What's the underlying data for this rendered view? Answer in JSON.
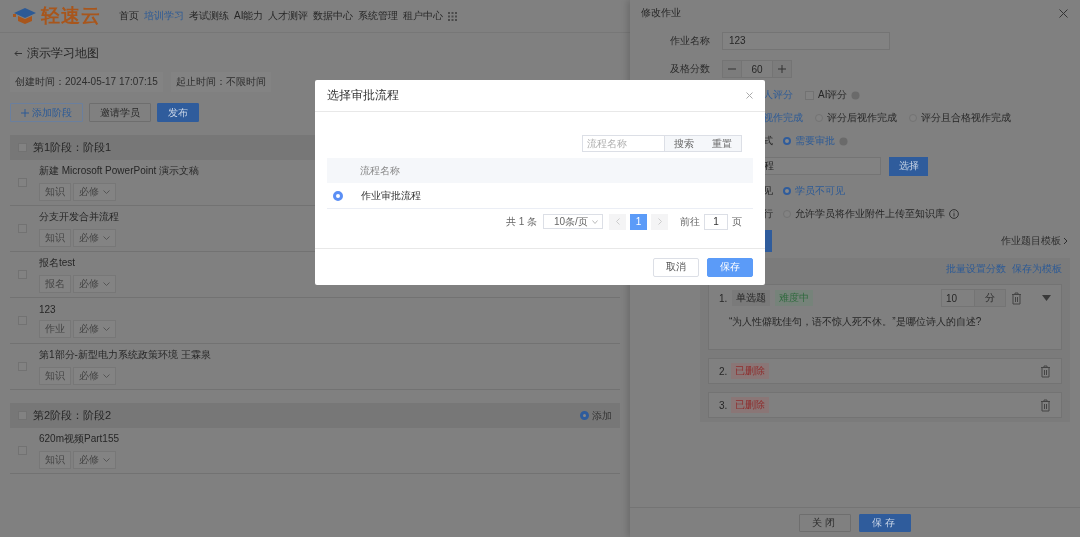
{
  "header": {
    "logo": "轻速云",
    "nav": [
      {
        "label": "首页",
        "selected": false
      },
      {
        "label": "培训学习",
        "selected": true
      },
      {
        "label": "考试测练",
        "selected": false
      },
      {
        "label": "AI能力",
        "selected": false
      },
      {
        "label": "人才测评",
        "selected": false
      },
      {
        "label": "数据中心",
        "selected": false
      },
      {
        "label": "系统管理",
        "selected": false
      },
      {
        "label": "租户中心",
        "selected": false
      }
    ]
  },
  "page": {
    "title": "演示学习地图",
    "meta": [
      "创建时间：2024-05-17 17:07:15",
      "起止时间：不限时间"
    ],
    "actions": [
      {
        "label": "添加阶段",
        "kind": "add"
      },
      {
        "label": "邀请学员",
        "kind": "default"
      },
      {
        "label": "发布",
        "kind": "primary"
      }
    ],
    "stages": [
      {
        "title": "第1阶段：阶段1",
        "checked": false,
        "items": [
          {
            "title": "新建 Microsoft PowerPoint 演示文稿",
            "checked": false,
            "type": "知识",
            "requirement": "必修"
          },
          {
            "title": "分支开发合并流程",
            "checked": false,
            "type": "知识",
            "requirement": "必修"
          },
          {
            "title": "报名test",
            "checked": false,
            "type": "报名",
            "requirement": "必修"
          },
          {
            "title": "123",
            "checked": false,
            "type": "作业",
            "requirement": "必修"
          },
          {
            "title": "第1部分-新型电力系统政策环境 王霖泉",
            "checked": false,
            "type": "知识",
            "requirement": "必修"
          }
        ]
      },
      {
        "title": "第2阶段：阶段2",
        "checked": false,
        "action": "添加",
        "items": [
          {
            "title": "620m视频Part155",
            "checked": false,
            "type": "知识",
            "requirement": "必修"
          }
        ]
      }
    ]
  },
  "drawer": {
    "title": "修改作业",
    "rows": [
      {
        "kind": "text",
        "label": "作业名称",
        "value": "123"
      },
      {
        "kind": "stepper",
        "label": "及格分数",
        "value": "60"
      },
      {
        "kind": "choices",
        "options": [
          {
            "kind": "text",
            "label": "人评分",
            "selected": true
          },
          {
            "kind": "checkbox",
            "label": "AI评分",
            "checked": false,
            "info": true
          }
        ]
      },
      {
        "kind": "choices",
        "options": [
          {
            "kind": "text",
            "label": "视作完成",
            "selected": true
          },
          {
            "kind": "radio",
            "label": "评分后视作完成",
            "selected": false
          },
          {
            "kind": "radio",
            "label": "评分且合格视作完成",
            "selected": false
          }
        ]
      },
      {
        "kind": "choices",
        "label": "式",
        "options": [
          {
            "kind": "radio",
            "label": "需要审批",
            "selected": true,
            "info": true
          }
        ]
      },
      {
        "kind": "picker",
        "value": "程",
        "button": "选择"
      },
      {
        "kind": "choices",
        "label": "见",
        "options": [
          {
            "kind": "radio",
            "label": "学员不可见",
            "selected": true
          }
        ]
      },
      {
        "kind": "choices",
        "label": "行",
        "options": [
          {
            "kind": "radio",
            "label": "允许学员将作业附件上传至知识库",
            "selected": false,
            "help": true
          }
        ]
      },
      {
        "kind": "template",
        "link": "作业题目模板"
      }
    ],
    "questions": {
      "links": [
        "批量设置分数",
        "保存为模板"
      ],
      "items": [
        {
          "kind": "question",
          "number": "1.",
          "type": "单选题",
          "difficulty": "难度中",
          "score": "10",
          "unit": "分",
          "text": "“为人性僻耽佳句，语不惊人死不休。”是哪位诗人的自述?"
        },
        {
          "kind": "deleted",
          "number": "2.",
          "status": "已删除"
        },
        {
          "kind": "deleted",
          "number": "3.",
          "status": "已删除"
        }
      ]
    },
    "buttons": [
      {
        "label": "关闭",
        "kind": "default"
      },
      {
        "label": "保存",
        "kind": "primary"
      }
    ]
  },
  "dialog": {
    "title": "选择审批流程",
    "search": {
      "placeholder": "流程名称",
      "buttons": [
        "搜索",
        "重置"
      ]
    },
    "table": {
      "columns": [
        "流程名称"
      ],
      "rows": [
        {
          "name": "作业审批流程",
          "selected": true
        }
      ]
    },
    "pagination": {
      "total": "共 1 条",
      "page_size": "10条/页",
      "pages": [
        {
          "label": "1",
          "selected": true
        }
      ],
      "goto_label": "前往",
      "goto_value": "1",
      "goto_suffix": "页"
    },
    "buttons": [
      {
        "label": "取消",
        "kind": "default"
      },
      {
        "label": "保存",
        "kind": "primary"
      }
    ]
  }
}
